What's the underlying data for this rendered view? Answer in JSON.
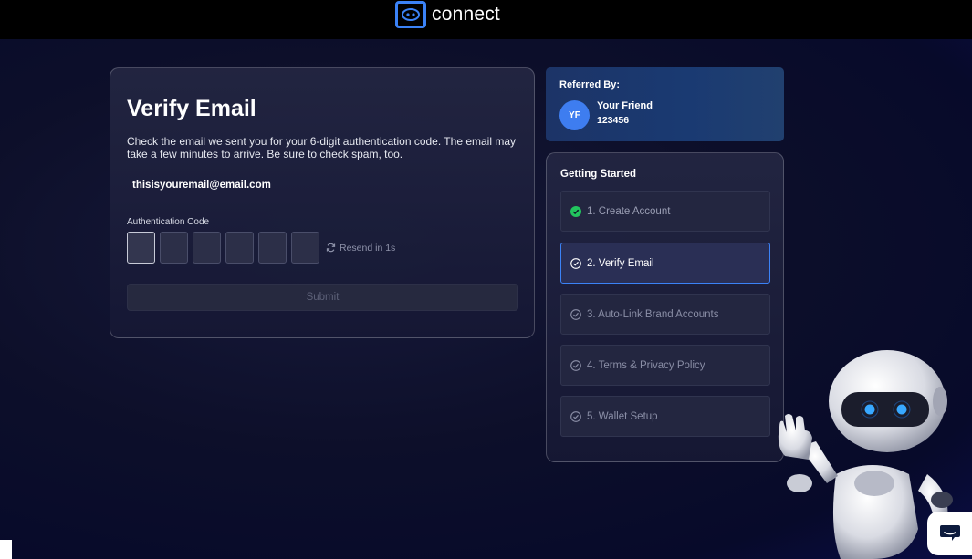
{
  "brand": {
    "name": "connect"
  },
  "verify": {
    "title": "Verify Email",
    "description": "Check the email we sent you for your 6-digit authentication code. The email may take a few minutes to arrive. Be sure to check spam, too.",
    "email": "thisisyouremail@email.com",
    "code_label": "Authentication Code",
    "code_digits": [
      "",
      "",
      "",
      "",
      "",
      ""
    ],
    "resend_label": "Resend in 1s",
    "submit_label": "Submit"
  },
  "referral": {
    "title": "Referred By:",
    "initials": "YF",
    "name": "Your Friend",
    "code": "123456"
  },
  "steps": {
    "title": "Getting Started",
    "items": [
      {
        "label": "1. Create Account",
        "status": "done"
      },
      {
        "label": "2. Verify Email",
        "status": "active"
      },
      {
        "label": "3. Auto-Link Brand Accounts",
        "status": "pending"
      },
      {
        "label": "4. Terms & Privacy Policy",
        "status": "pending"
      },
      {
        "label": "5. Wallet Setup",
        "status": "pending"
      }
    ]
  },
  "colors": {
    "accent": "#3b82f6",
    "success": "#22c55e",
    "background": "#0d0f2a"
  },
  "icons": {
    "brand": "connect-logo-icon",
    "resend": "refresh-icon",
    "step_done": "check-circle-icon",
    "step_pending": "circle-check-outline-icon",
    "chat": "chat-bubble-icon"
  }
}
